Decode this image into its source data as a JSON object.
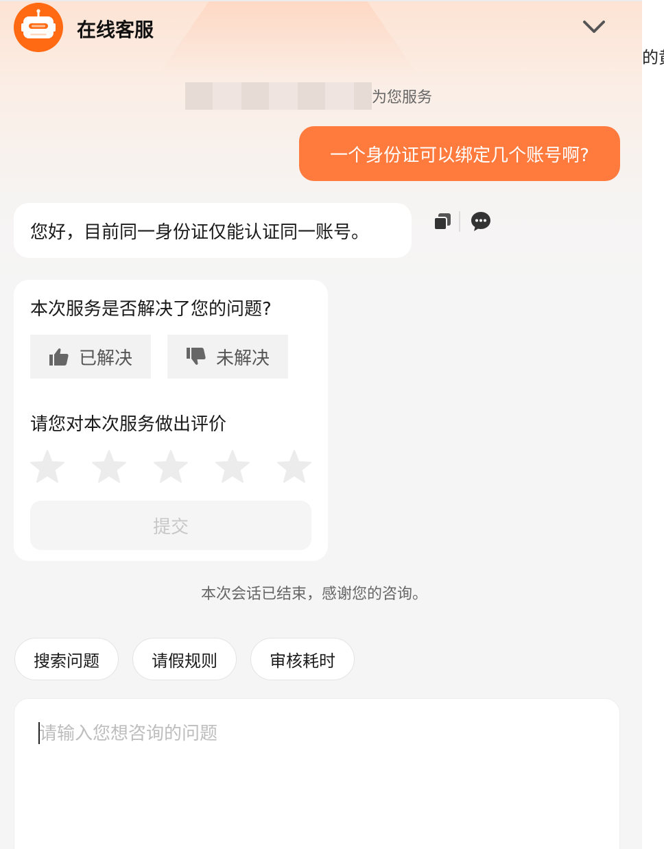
{
  "header": {
    "title": "在线客服",
    "logo_icon": "robot-icon",
    "collapse_icon": "chevron-down-icon"
  },
  "notice": {
    "service_suffix": "为您服务"
  },
  "messages": {
    "user": "一个身份证可以绑定几个账号啊?",
    "bot": "您好，目前同一身份证仅能认证同一账号。"
  },
  "message_tools": {
    "copy_icon": "copy-icon",
    "comment_icon": "comment-icon"
  },
  "feedback": {
    "question": "本次服务是否解决了您的问题?",
    "resolved_label": "已解决",
    "unresolved_label": "未解决",
    "rating_title": "请您对本次服务做出评价",
    "stars": 5,
    "rating": 0,
    "submit_label": "提交"
  },
  "session_end": "本次会话已结束，感谢您的咨询。",
  "quick_chips": [
    "搜索问题",
    "请假规则",
    "审核耗时"
  ],
  "input": {
    "placeholder": "请输入您想咨询的问题",
    "value": ""
  },
  "side_text": "的黄",
  "colors": {
    "accent": "#ff7a3d",
    "logo": "#ff6a13"
  }
}
